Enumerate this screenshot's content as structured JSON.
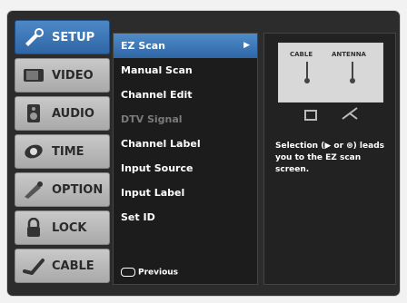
{
  "sidebar": {
    "items": [
      {
        "label": "SETUP",
        "icon": "setup-icon",
        "active": true
      },
      {
        "label": "VIDEO",
        "icon": "video-icon",
        "active": false
      },
      {
        "label": "AUDIO",
        "icon": "audio-icon",
        "active": false
      },
      {
        "label": "TIME",
        "icon": "time-icon",
        "active": false
      },
      {
        "label": "OPTION",
        "icon": "option-icon",
        "active": false
      },
      {
        "label": "LOCK",
        "icon": "lock-icon",
        "active": false
      },
      {
        "label": "CABLE",
        "icon": "cable-icon",
        "active": false
      }
    ]
  },
  "menu": {
    "items": [
      {
        "label": "EZ Scan",
        "selected": true,
        "disabled": false,
        "has_arrow": true
      },
      {
        "label": "Manual Scan",
        "selected": false,
        "disabled": false
      },
      {
        "label": "Channel Edit",
        "selected": false,
        "disabled": false
      },
      {
        "label": "DTV Signal",
        "selected": false,
        "disabled": true
      },
      {
        "label": "Channel Label",
        "selected": false,
        "disabled": false
      },
      {
        "label": "Input Source",
        "selected": false,
        "disabled": false
      },
      {
        "label": "Input Label",
        "selected": false,
        "disabled": false
      },
      {
        "label": "Set ID",
        "selected": false,
        "disabled": false
      }
    ],
    "arrow": "▶",
    "footer": "Previous"
  },
  "diagram": {
    "cable_label": "CABLE",
    "antenna_label": "ANTENNA"
  },
  "help": {
    "text": "Selection (▶ or ⊛) leads you to the EZ scan screen."
  },
  "colors": {
    "active": "#3a74b5",
    "osd_bg": "#2c2c2c"
  }
}
